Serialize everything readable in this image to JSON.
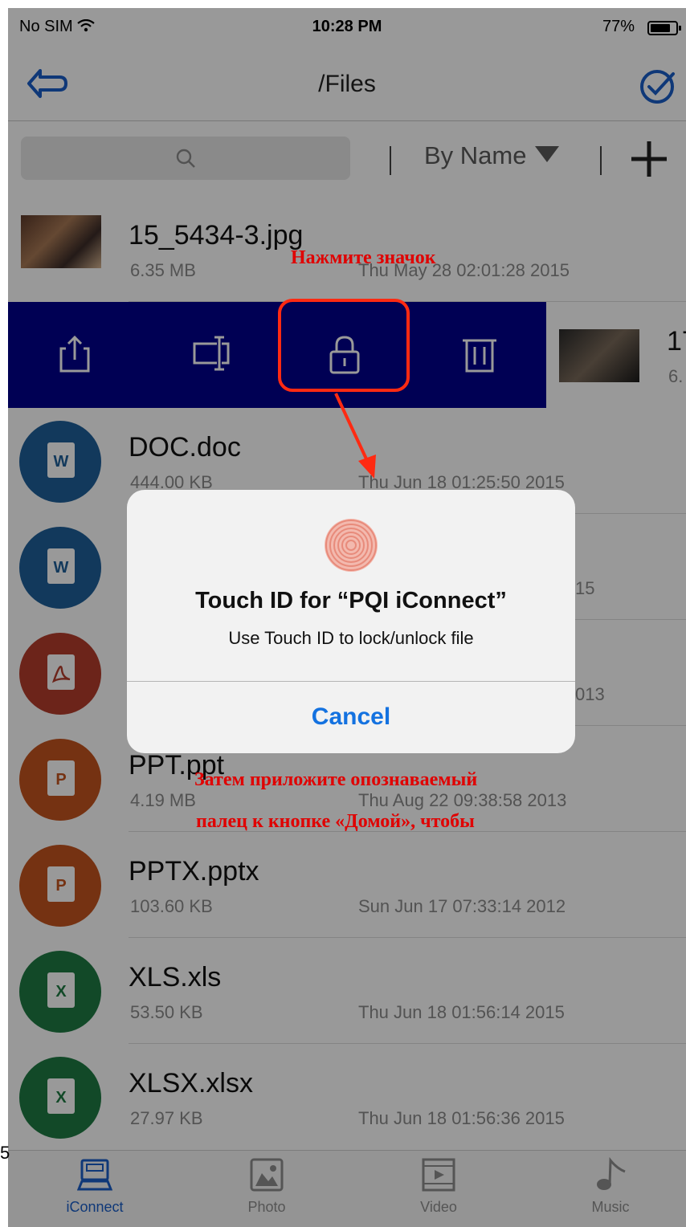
{
  "status": {
    "carrier": "No SIM",
    "time": "10:28 PM",
    "battery": "77%"
  },
  "nav": {
    "title": "/Files"
  },
  "toolbar": {
    "sort_label": "By Name"
  },
  "files": [
    {
      "name": "15_5434-3.jpg",
      "size": "6.35 MB",
      "date": "Thu May 28 02:01:28 2015",
      "type": "jpg"
    },
    {
      "name": "17",
      "size": "6.",
      "type": "jpg"
    },
    {
      "name": "DOC.doc",
      "size": "444.00 KB",
      "date": "Thu Jun 18 01:25:50 2015",
      "type": "doc",
      "letter": "W"
    },
    {
      "name": "",
      "size": "",
      "date": "15",
      "type": "doc",
      "letter": "W"
    },
    {
      "name": "",
      "size": "",
      "date": "013",
      "type": "pdf"
    },
    {
      "name": "PPT.ppt",
      "size": "4.19 MB",
      "date": "Thu Aug 22 09:38:58 2013",
      "type": "ppt",
      "letter": "P"
    },
    {
      "name": "PPTX.pptx",
      "size": "103.60 KB",
      "date": "Sun Jun 17 07:33:14 2012",
      "type": "ppt",
      "letter": "P"
    },
    {
      "name": "XLS.xls",
      "size": "53.50 KB",
      "date": "Thu Jun 18 01:56:14 2015",
      "type": "xls",
      "letter": "X"
    },
    {
      "name": "XLSX.xlsx",
      "size": "27.97 KB",
      "date": "Thu Jun 18 01:56:36 2015",
      "type": "xls",
      "letter": "X"
    }
  ],
  "alert": {
    "title": "Touch ID for “PQI iConnect”",
    "message": "Use Touch ID to lock/unlock file",
    "cancel": "Cancel"
  },
  "annotations": {
    "tap_icon": "Нажмите значок",
    "line1": "Затем приложите опознаваемый",
    "line2": "палец к кнопке «Домой», чтобы"
  },
  "edge_note": "5",
  "tabs": [
    {
      "label": "iConnect",
      "icon": "sd-card-icon",
      "active": true
    },
    {
      "label": "Photo",
      "icon": "photo-icon",
      "active": false
    },
    {
      "label": "Video",
      "icon": "video-icon",
      "active": false
    },
    {
      "label": "Music",
      "icon": "music-note-icon",
      "active": false
    }
  ],
  "colors": {
    "accent": "#1a5ec8",
    "swipe_bg": "#00008c",
    "doc": "#1f5f99",
    "pdf": "#b43c2c",
    "ppt": "#c4541e",
    "xls": "#1e7b43",
    "annotation": "#e00000"
  }
}
